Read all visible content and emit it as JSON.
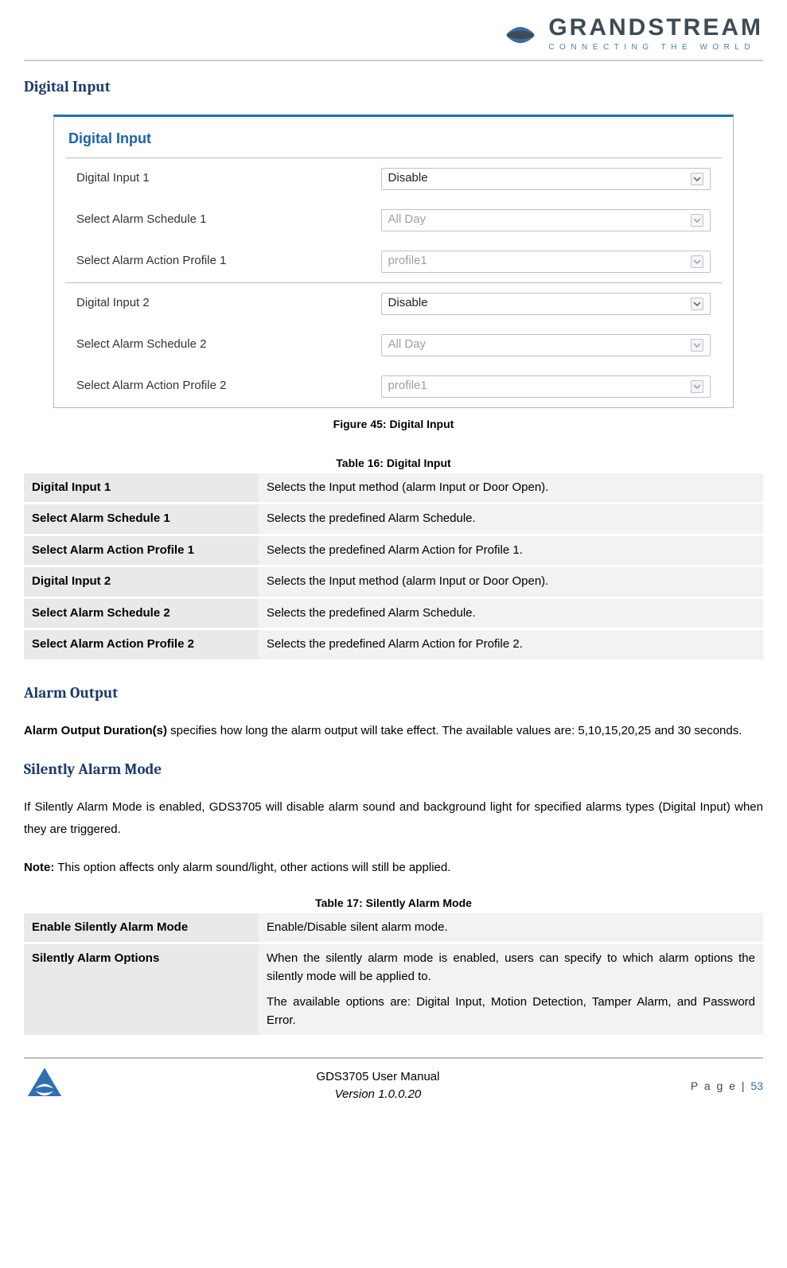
{
  "brand": {
    "name": "GRANDSTREAM",
    "tagline": "CONNECTING THE WORLD"
  },
  "sections": {
    "digital_input_heading": "Digital Input",
    "alarm_output_heading": "Alarm Output",
    "silently_alarm_mode_heading": "Silently Alarm Mode"
  },
  "figure45": {
    "title": "Digital Input",
    "caption": "Figure 45: Digital Input",
    "rows": [
      {
        "label": "Digital Input 1",
        "value": "Disable",
        "enabled": true
      },
      {
        "label": "Select Alarm Schedule 1",
        "value": "All Day",
        "enabled": false
      },
      {
        "label": "Select Alarm Action Profile 1",
        "value": "profile1",
        "enabled": false
      },
      {
        "label": "Digital Input 2",
        "value": "Disable",
        "enabled": true
      },
      {
        "label": "Select Alarm Schedule 2",
        "value": "All Day",
        "enabled": false
      },
      {
        "label": "Select Alarm Action Profile 2",
        "value": "profile1",
        "enabled": false
      }
    ]
  },
  "table16": {
    "caption": "Table 16: Digital Input",
    "rows": [
      {
        "name": "Digital Input 1",
        "desc": "Selects the Input method (alarm Input or Door Open)."
      },
      {
        "name": "Select Alarm Schedule 1",
        "desc": "Selects the predefined Alarm Schedule."
      },
      {
        "name": "Select Alarm Action Profile 1",
        "desc": "Selects the predefined Alarm Action for Profile 1."
      },
      {
        "name": "Digital Input 2",
        "desc": "Selects the Input method (alarm Input or Door Open)."
      },
      {
        "name": "Select Alarm Schedule 2",
        "desc": "Selects the predefined Alarm Schedule."
      },
      {
        "name": "Select Alarm Action Profile 2",
        "desc": "Selects the predefined Alarm Action for Profile 2."
      }
    ]
  },
  "alarm_output": {
    "lead_bold": "Alarm Output Duration(s)",
    "lead_rest": " specifies how long the alarm output will take effect. The available values are: 5,10,15,20,25 and 30 seconds."
  },
  "silently": {
    "p1": "If Silently Alarm Mode is enabled, GDS3705 will disable alarm sound and background light for specified alarms types (Digital Input) when they are triggered.",
    "note_bold": "Note:",
    "note_rest": " This option affects only alarm sound/light, other actions will still be applied."
  },
  "table17": {
    "caption": "Table 17: Silently Alarm Mode",
    "rows": [
      {
        "name": "Enable Silently Alarm Mode",
        "desc": [
          "Enable/Disable silent alarm mode."
        ]
      },
      {
        "name": "Silently Alarm Options",
        "desc": [
          "When the silently alarm mode is enabled, users can specify to which alarm options the silently mode will be applied to.",
          "The available options are: Digital Input, Motion Detection, Tamper Alarm, and Password Error."
        ]
      }
    ]
  },
  "footer": {
    "title": "GDS3705 User Manual",
    "version": "Version 1.0.0.20",
    "page_label": "P a g e  | ",
    "page_num": "53"
  }
}
